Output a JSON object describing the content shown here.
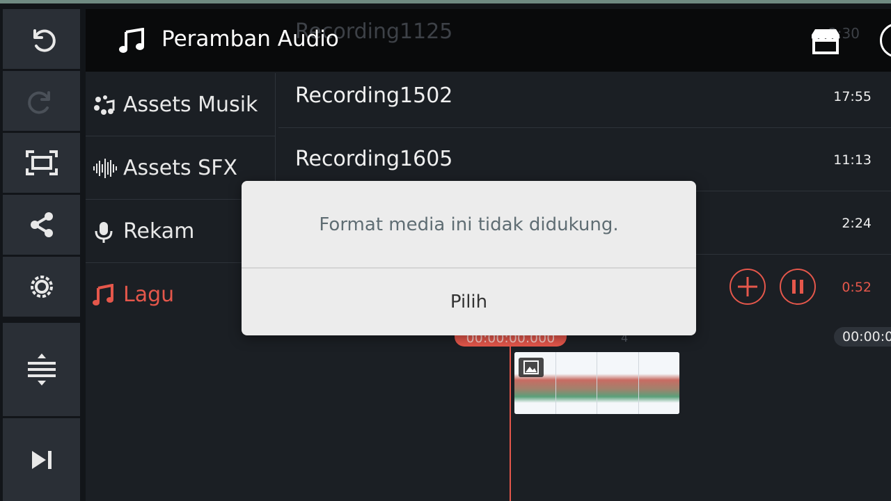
{
  "panel": {
    "title": "Peramban Audio",
    "store_icon": "store-icon",
    "ghost_track": {
      "name": "Recording1125",
      "duration": "2:30"
    }
  },
  "sidebar_nav": [
    {
      "label": "Assets Musik",
      "icon": "music-assets-icon"
    },
    {
      "label": "Assets SFX",
      "icon": "waveform-icon"
    },
    {
      "label": "Rekam",
      "icon": "microphone-icon"
    },
    {
      "label": "Lagu",
      "icon": "music-note-icon",
      "active": true
    }
  ],
  "tracks": [
    {
      "name": "Recording1502",
      "duration": "17:55"
    },
    {
      "name": "Recording1605",
      "duration": "11:13"
    },
    {
      "name": "",
      "duration": "2:24"
    },
    {
      "name": "",
      "duration": "0:52",
      "playing": true
    }
  ],
  "toolbar": [
    "undo-icon",
    "redo-icon",
    "fit-screen-icon",
    "share-icon",
    "settings-icon",
    "split-tracks-icon",
    "skip-end-icon"
  ],
  "timeline": {
    "playhead_time": "00:00:00.000",
    "end_time": "00:00:0",
    "marker": "4"
  },
  "dialog": {
    "message": "Format media ini tidak didukung.",
    "button": "Pilih"
  },
  "colors": {
    "accent": "#e5574b",
    "panel": "#1b1f24",
    "header": "#090a0b",
    "toolbar_button": "#2a2f36"
  }
}
